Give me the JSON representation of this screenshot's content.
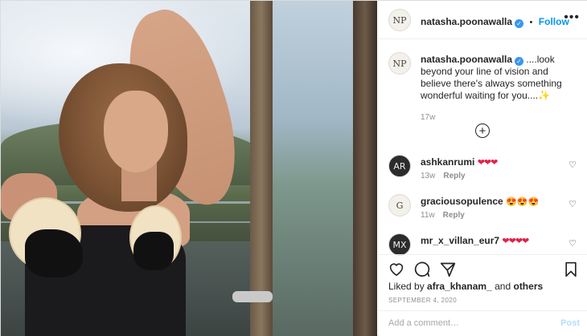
{
  "post": {
    "author": "natasha.poonawalla",
    "follow_label": "Follow",
    "separator": "•",
    "avatar_initials": "NP",
    "more_icon": "more-horizontal-icon",
    "verified_icon": "verified-badge-icon",
    "caption_author": "natasha.poonawalla",
    "caption_text": "....look beyond your line of vision and believe there's always something wonderful waiting for you....✨",
    "caption_age": "17w",
    "add_comment_icon": "plus-circle-icon"
  },
  "comments": [
    {
      "user": "ashkanrumi",
      "text": "❤❤❤",
      "age": "13w",
      "reply": "Reply",
      "avatar_initials": "AR"
    },
    {
      "user": "graciousopulence",
      "text": "😍😍😍",
      "age": "11w",
      "reply": "Reply",
      "avatar_initials": "G"
    },
    {
      "user": "mr_x_villan_eur7",
      "text": "❤❤❤❤",
      "age": "",
      "reply": "",
      "avatar_initials": "MX"
    }
  ],
  "actions": {
    "like_icon": "heart-icon",
    "comment_icon": "comment-icon",
    "share_icon": "paper-plane-icon",
    "save_icon": "bookmark-icon",
    "liked_prefix": "Liked by",
    "liked_user": "afra_khanam_",
    "liked_and": "and",
    "liked_others": "others",
    "date": "SEPTEMBER 4, 2020"
  },
  "composer": {
    "placeholder": "Add a comment…",
    "post_label": "Post"
  },
  "colors": {
    "accent": "#0095f6",
    "verified": "#3897f0",
    "post_disabled": "#b2dffc",
    "heart_red": "#e0224b"
  }
}
